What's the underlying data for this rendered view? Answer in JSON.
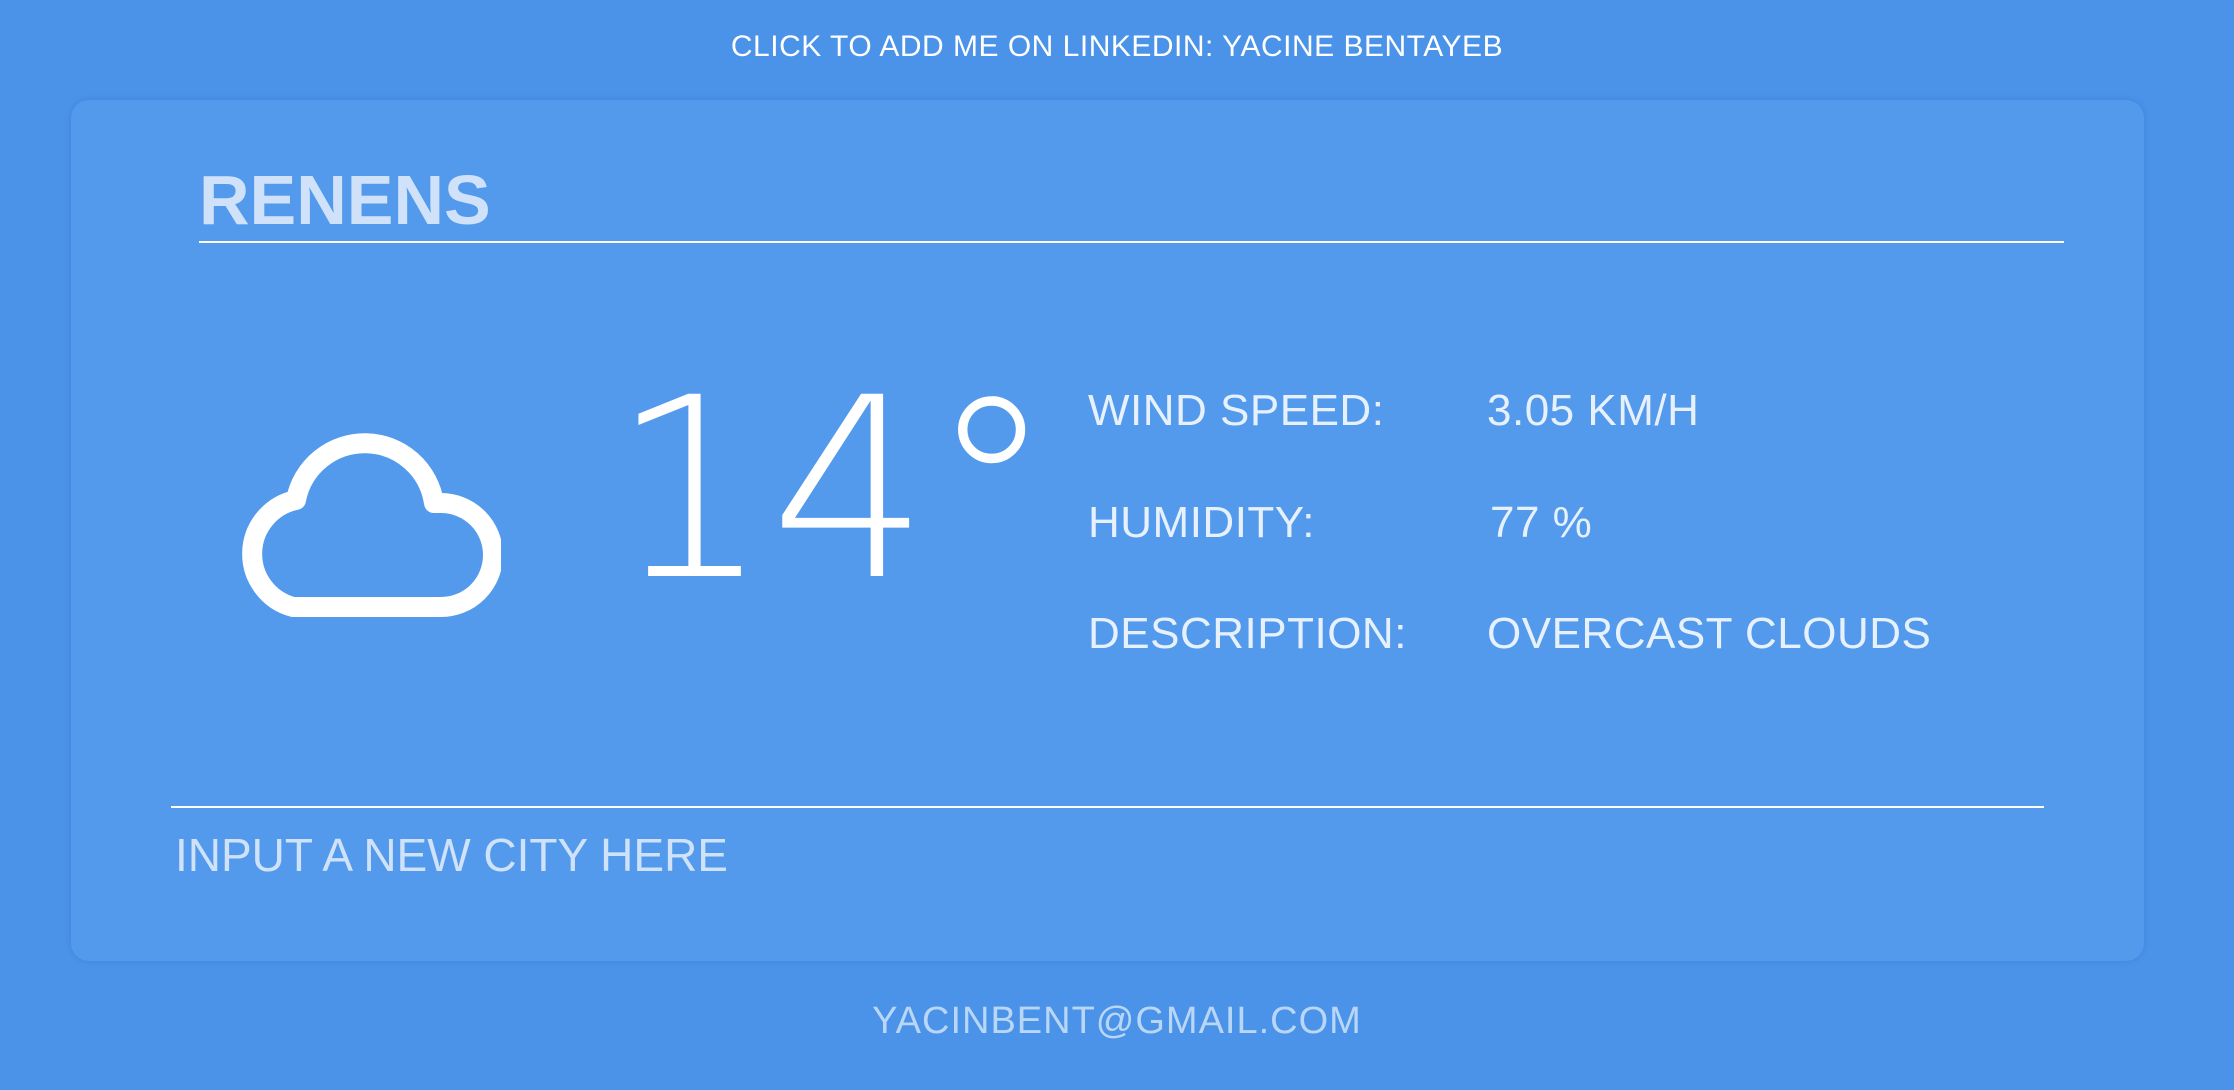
{
  "header": {
    "linkedin_link": "CLICK TO ADD ME ON LINKEDIN: YACINE BENTAYEB"
  },
  "weather": {
    "city": "RENENS",
    "icon": "cloud-icon",
    "temperature": "14°",
    "details": [
      {
        "label": "WIND SPEED:",
        "value": "3.05 KM/H"
      },
      {
        "label": "HUMIDITY:",
        "value": "77 %"
      },
      {
        "label": "DESCRIPTION:",
        "value": "OVERCAST CLOUDS"
      }
    ]
  },
  "search": {
    "placeholder": "INPUT A NEW CITY HERE",
    "value": ""
  },
  "footer": {
    "email": "YACINBENT@GMAIL.COM"
  },
  "colors": {
    "background": "#4a93e9",
    "card": "#539aec",
    "text": "#ffffff",
    "muted": "#cfe2f9"
  }
}
